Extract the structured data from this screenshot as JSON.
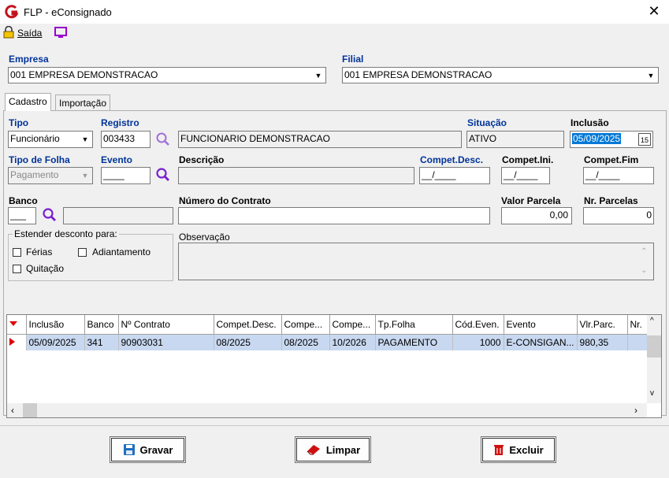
{
  "window": {
    "title": "FLP - eConsignado",
    "close_glyph": "✕"
  },
  "toolbar": {
    "exit_label": "Saída"
  },
  "empresa": {
    "label": "Empresa",
    "value": "001 EMPRESA DEMONSTRACAO"
  },
  "filial": {
    "label": "Filial",
    "value": "001 EMPRESA DEMONSTRACAO"
  },
  "tabs": [
    {
      "label": "Cadastro"
    },
    {
      "label": "Importação"
    }
  ],
  "form": {
    "tipo": {
      "label": "Tipo",
      "value": "Funcionário"
    },
    "registro": {
      "label": "Registro",
      "value": "003433"
    },
    "nome": {
      "value": "FUNCIONARIO DEMONSTRACAO"
    },
    "situacao": {
      "label": "Situação",
      "value": "ATIVO"
    },
    "inclusao": {
      "label": "Inclusão",
      "value": "05/09/2025",
      "cal": "15"
    },
    "tipo_folha": {
      "label": "Tipo de Folha",
      "value": "Pagamento"
    },
    "evento": {
      "label": "Evento",
      "value": "____"
    },
    "descricao": {
      "label": "Descrição",
      "value": ""
    },
    "compet_desc": {
      "label": "Compet.Desc.",
      "value": "__/____"
    },
    "compet_ini": {
      "label": "Compet.Ini.",
      "value": "__/____"
    },
    "compet_fim": {
      "label": "Compet.Fim",
      "value": "__/____"
    },
    "banco": {
      "label": "Banco",
      "value": "___"
    },
    "numero_contrato": {
      "label": "Número do Contrato",
      "value": ""
    },
    "valor_parcela": {
      "label": "Valor Parcela",
      "value": "0,00"
    },
    "nr_parcelas": {
      "label": "Nr. Parcelas",
      "value": "0"
    },
    "estender": {
      "legend": "Estender desconto para:",
      "ferias": "Férias",
      "adiantamento": "Adiantamento",
      "quitacao": "Quitação"
    },
    "observacao": {
      "label": "Observação",
      "value": ""
    }
  },
  "grid": {
    "columns": [
      "Inclusão",
      "Banco",
      "Nº Contrato",
      "Compet.Desc.",
      "Compe...",
      "Compe...",
      "Tp.Folha",
      "Cód.Even.",
      "Evento",
      "Vlr.Parc.",
      "Nr."
    ],
    "rows": [
      [
        "05/09/2025",
        "341",
        "90903031",
        "08/2025",
        "08/2025",
        "10/2026",
        "PAGAMENTO",
        "1000",
        "E-CONSIGAN...",
        "980,35",
        ""
      ]
    ]
  },
  "buttons": {
    "gravar": "Gravar",
    "limpar": "Limpar",
    "excluir": "Excluir"
  },
  "colors": {
    "label_blue": "#003399",
    "selection": "#c8d8f0",
    "excluir_red": "#d01010",
    "gravar_blue": "#1f6fc0"
  }
}
